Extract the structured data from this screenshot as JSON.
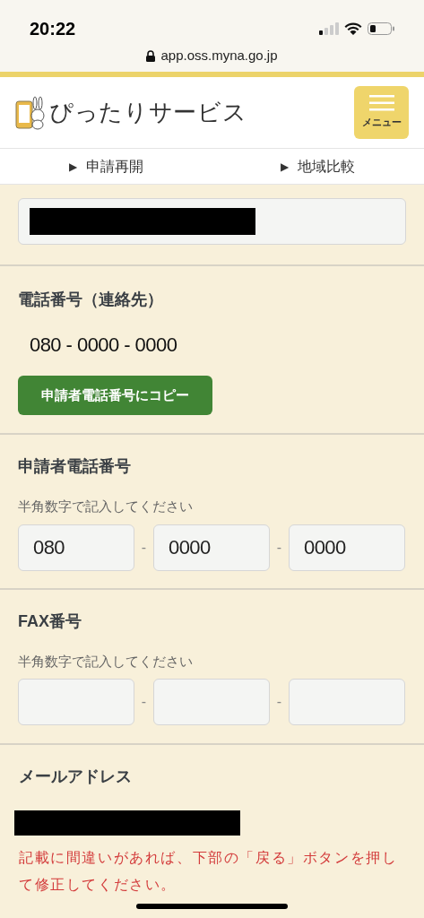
{
  "status_bar": {
    "time": "20:22",
    "url": "app.oss.myna.go.jp"
  },
  "header": {
    "title": "ぴったりサービス",
    "menu_label": "メニュー"
  },
  "nav": [
    {
      "label": "申請再開",
      "icon": "▶"
    },
    {
      "label": "地域比較",
      "icon": "▶"
    }
  ],
  "top_field": {
    "redacted": true
  },
  "contact_phone": {
    "title": "電話番号（連絡先）",
    "value": "080 - 0000 - 0000",
    "copy_button": "申請者電話番号にコピー"
  },
  "applicant_phone": {
    "title": "申請者電話番号",
    "hint": "半角数字で記入してください",
    "parts": [
      {
        "kind": "input",
        "value": "080"
      },
      {
        "kind": "input",
        "value": "0000"
      },
      {
        "kind": "input",
        "value": "0000"
      }
    ],
    "separators": [
      "-",
      "-"
    ]
  },
  "fax": {
    "title": "FAX番号",
    "hint": "半角数字で記入してください",
    "parts": [
      {
        "kind": "input"
      },
      {
        "kind": "input"
      },
      {
        "kind": "input"
      }
    ],
    "separators": [
      "-",
      "-"
    ]
  },
  "email": {
    "title": "メールアドレス",
    "redacted": true,
    "warning": "記載に間違いがあれば、下部の「戻る」ボタンを押して修正してください。"
  }
}
